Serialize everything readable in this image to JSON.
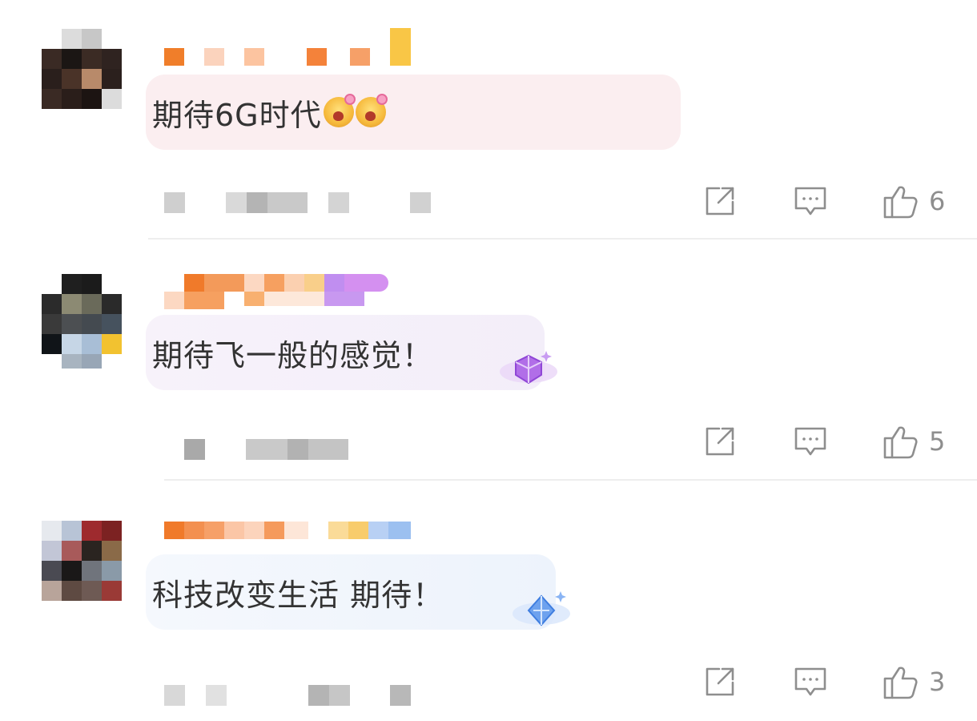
{
  "comments": [
    {
      "text": "期待6G时代",
      "likes": "6",
      "emoji": "drooling-face-emoji x2"
    },
    {
      "text": "期待飞一般的感觉！",
      "likes": "5",
      "badge": "purple-diamond-icon"
    },
    {
      "text": "科技改变生活 期待！",
      "likes": "3",
      "badge": "blue-diamond-icon"
    }
  ],
  "colors": {
    "text": "#333333",
    "icon": "#8e8e8e",
    "bubble1": "#fbeef0",
    "bubble2": "#f6eef9",
    "bubble3": "#eef4fc"
  }
}
